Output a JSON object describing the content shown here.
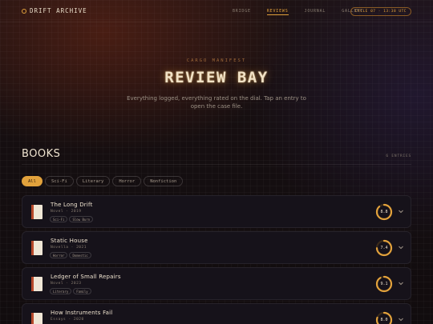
{
  "header": {
    "brand": "DRIFT ARCHIVE",
    "nav": [
      {
        "label": "BRIDGE",
        "active": false
      },
      {
        "label": "REVIEWS",
        "active": true
      },
      {
        "label": "JOURNAL",
        "active": false
      },
      {
        "label": "GALLERY",
        "active": false
      }
    ],
    "clock": "CYCLE 07 · 13:38 UTC"
  },
  "hero": {
    "kicker": "CARGO MANIFEST",
    "title": "REVIEW BAY",
    "subtitle": "Everything logged, everything rated on the dial. Tap an entry to open the case file."
  },
  "section": {
    "title": "BOOKS",
    "count": "6 ENTRIES"
  },
  "filters": [
    "All",
    "Sci-Fi",
    "Literary",
    "Horror",
    "Nonfiction"
  ],
  "active_filter": "All",
  "colors": {
    "accent": "#e2a23c",
    "book_spine": "#b7482a",
    "card_bg": "#16121a"
  },
  "entries": [
    {
      "title": "The Long Drift",
      "meta": "Novel · 2019",
      "tags": [
        "Sci-Fi",
        "Slow Burn"
      ],
      "rating": "8.8",
      "rating_fraction": 0.88
    },
    {
      "title": "Static House",
      "meta": "Novella · 2021",
      "tags": [
        "Horror",
        "Domestic"
      ],
      "rating": "7.4",
      "rating_fraction": 0.74
    },
    {
      "title": "Ledger of Small Repairs",
      "meta": "Novel · 2023",
      "tags": [
        "Literary",
        "Family"
      ],
      "rating": "9.1",
      "rating_fraction": 0.91
    },
    {
      "title": "How Instruments Fail",
      "meta": "Essays · 2020",
      "tags": [],
      "rating": "8.0",
      "rating_fraction": 0.8
    }
  ],
  "icons": {
    "brand": "ring-dot-icon",
    "entry": "book-icon",
    "expand": "chevron-down-icon"
  }
}
